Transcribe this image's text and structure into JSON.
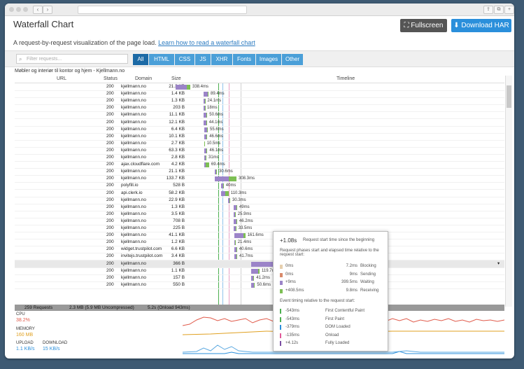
{
  "title": "Waterfall Chart",
  "fullscreen_label": "Fullscreen",
  "download_label": "Download HAR",
  "subtitle_text": "A request-by-request visualization of the page load.",
  "subtitle_link": "Learn how to read a waterfall chart",
  "filter_placeholder": "Filter requests...",
  "tabs": [
    "All",
    "HTML",
    "CSS",
    "JS",
    "XHR",
    "Fonts",
    "Images",
    "Other"
  ],
  "page_title": "Møbler og interiør til kontor og hjem - Kjellmann.no",
  "columns": {
    "url": "URL",
    "status": "Status",
    "domain": "Domain",
    "size": "Size",
    "timeline": "Timeline"
  },
  "colors": {
    "blocking": "#e6cfae",
    "sending": "#d98a6b",
    "waiting": "#9b84c8",
    "receiving": "#7dbf54",
    "accent": "#2a8fdb"
  },
  "rows": [
    {
      "url": "/",
      "status": "200",
      "domain": "kjellmann.no",
      "size": "21.3 KB",
      "time": "338.4ms",
      "start": 0,
      "wait": 155,
      "recv": 55
    },
    {
      "url": "logo.svg",
      "status": "200",
      "domain": "kjellmann.no",
      "size": "1.4 KB",
      "time": "89.4ms",
      "start": 395,
      "wait": 60,
      "recv": 15
    },
    {
      "url": "kjellmann-icon.avg",
      "status": "200",
      "domain": "kjellmann.no",
      "size": "1.3 KB",
      "time": "24.1ms",
      "start": 400,
      "wait": 20,
      "recv": 4
    },
    {
      "url": "dummy.png",
      "status": "200",
      "domain": "kjellmann.no",
      "size": "203 B",
      "time": "18ms",
      "start": 402,
      "wait": 14,
      "recv": 4
    },
    {
      "url": "kontormobler.jpg",
      "status": "200",
      "domain": "kjellmann.no",
      "size": "11.1 KB",
      "time": "50.6ms",
      "start": 403,
      "wait": 40,
      "recv": 10
    },
    {
      "url": "konferanse-og-moterom.jpg",
      "status": "200",
      "domain": "kjellmann.no",
      "size": "12.1 KB",
      "time": "44.1ms",
      "start": 404,
      "wait": 36,
      "recv": 8
    },
    {
      "url": "resepsjon.jpg",
      "status": "200",
      "domain": "kjellmann.no",
      "size": "6.4 KB",
      "time": "55.6ms",
      "start": 405,
      "wait": 45,
      "recv": 10
    },
    {
      "url": "presentasjon-whiteboard.jpg",
      "status": "200",
      "domain": "kjellmann.no",
      "size": "10.1 KB",
      "time": "46.6ms",
      "start": 406,
      "wait": 38,
      "recv": 8
    },
    {
      "url": "lounge.jpg",
      "status": "200",
      "domain": "kjellmann.no",
      "size": "2.7 KB",
      "time": "10.5ms",
      "start": 407,
      "wait": 8,
      "recv": 2
    },
    {
      "url": "styles.css",
      "status": "200",
      "domain": "kjellmann.no",
      "size": "63.3 KB",
      "time": "46.1ms",
      "start": 408,
      "wait": 30,
      "recv": 16
    },
    {
      "url": "amsecookie.css",
      "status": "200",
      "domain": "kjellmann.no",
      "size": "2.8 KB",
      "time": "31ms",
      "start": 409,
      "wait": 24,
      "recv": 7
    },
    {
      "url": "rocket-loader.min.js",
      "status": "200",
      "domain": "ajax.cloudflare.com",
      "size": "4.2 KB",
      "time": "69.4ms",
      "start": 410,
      "wait": 20,
      "recv": 49
    },
    {
      "url": "print.css",
      "status": "200",
      "domain": "kjellmann.no",
      "size": "21.1 KB",
      "time": "30.6ms",
      "start": 560,
      "wait": 24,
      "recv": 7
    },
    {
      "url": "fa-light-300.woff2",
      "status": "200",
      "domain": "kjellmann.no",
      "size": "133.7 KB",
      "time": "308.3ms",
      "start": 562,
      "wait": 200,
      "recv": 108
    },
    {
      "url": "polyfill.min.js?features=default%...",
      "status": "200",
      "domain": "polyfill.io",
      "size": "528 B",
      "time": "40ms",
      "start": 648,
      "wait": 30,
      "recv": 10
    },
    {
      "url": "clerk.js",
      "status": "200",
      "domain": "api.clerk.io",
      "size": "58.2 KB",
      "time": "110.3ms",
      "start": 648,
      "wait": 60,
      "recv": 50
    },
    {
      "url": "5f2e37e3fd9b3dea1dd53e9f31fb0...",
      "status": "200",
      "domain": "kjellmann.no",
      "size": "22.9 KB",
      "time": "30.3ms",
      "start": 750,
      "wait": 24,
      "recv": 6
    },
    {
      "url": "kjellmann-icon-color_2_.ico",
      "status": "200",
      "domain": "kjellmann.no",
      "size": "1.3 KB",
      "time": "49ms",
      "start": 830,
      "wait": 40,
      "recv": 9
    },
    {
      "url": "jquery.mobile.custom.min.js",
      "status": "200",
      "domain": "kjellmann.no",
      "size": "3.5 KB",
      "time": "25.9ms",
      "start": 832,
      "wait": 20,
      "recv": 6
    },
    {
      "url": "dataPost.min.js",
      "status": "200",
      "domain": "kjellmann.no",
      "size": "708 B",
      "time": "46.2ms",
      "start": 833,
      "wait": 38,
      "recv": 8
    },
    {
      "url": "bootstrap.min.js",
      "status": "200",
      "domain": "kjellmann.no",
      "size": "225 B",
      "time": "33.5ms",
      "start": 834,
      "wait": 27,
      "recv": 6
    },
    {
      "url": "jquery.min.js",
      "status": "200",
      "domain": "kjellmann.no",
      "size": "41.1 KB",
      "time": "161.6ms",
      "start": 835,
      "wait": 130,
      "recv": 32
    },
    {
      "url": "main.min.js",
      "status": "200",
      "domain": "kjellmann.no",
      "size": "1.2 KB",
      "time": "21.4ms",
      "start": 836,
      "wait": 17,
      "recv": 4
    },
    {
      "url": "tp.widget.bootstrap.min.js",
      "status": "200",
      "domain": "widget.trustpilot.com",
      "size": "6.6 KB",
      "time": "40.6ms",
      "start": 837,
      "wait": 30,
      "recv": 11
    },
    {
      "url": "tp.min.js",
      "status": "200",
      "domain": "invitejs.trustpilot.com",
      "size": "3.4 KB",
      "time": "41.7ms",
      "start": 838,
      "wait": 32,
      "recv": 10
    },
    {
      "url": "am.ShopbyResponsive.min.js",
      "status": "200",
      "domain": "kjellmann.no",
      "size": "366 B",
      "time": "",
      "start": 1080,
      "wait": 399.5,
      "recv": 9.8,
      "hl": true
    },
    {
      "url": "translate-inline.min.js",
      "status": "200",
      "domain": "kjellmann.no",
      "size": "1.1 KB",
      "time": "119.7ms",
      "start": 1080,
      "wait": 100,
      "recv": 20
    },
    {
      "url": "tooltip.min.js",
      "status": "200",
      "domain": "kjellmann.no",
      "size": "157 B",
      "time": "41.2ms",
      "start": 1082,
      "wait": 33,
      "recv": 8
    },
    {
      "url": "responsive.min.js",
      "status": "200",
      "domain": "kjellmann.no",
      "size": "550 B",
      "time": "50.6ms",
      "start": 1084,
      "wait": 40,
      "recv": 10
    }
  ],
  "summary": {
    "requests": "259 Requests",
    "size": "2.3 MB  (5.9 MB Uncompressed)",
    "time": "5.2s  (Onload 943ms)"
  },
  "metrics": {
    "cpu_label": "CPU",
    "cpu_value": "38.2%",
    "memory_label": "MEMORY",
    "memory_value": "160 MB",
    "upload_label": "UPLOAD",
    "upload_value": "1.1 KB/s",
    "download_label": "DOWNLOAD",
    "download_value": "15 KB/s"
  },
  "tooltip": {
    "start": "+1.08s",
    "start_desc": "Request start time since the beginning",
    "phases_desc": "Request phases start and elapsed time relative to the request start:",
    "phases": [
      {
        "start": "0ms",
        "elapsed": "7.2ms",
        "name": "Blocking",
        "color": "#e6cfae"
      },
      {
        "start": "0ms",
        "elapsed": "9ms",
        "name": "Sending",
        "color": "#d98a6b"
      },
      {
        "start": "+9ms",
        "elapsed": "399.5ms",
        "name": "Waiting",
        "color": "#9b84c8"
      },
      {
        "start": "+408.5ms",
        "elapsed": "9.8ms",
        "name": "Receiving",
        "color": "#7dbf54"
      }
    ],
    "events_desc": "Event timing relative to the request start:",
    "events": [
      {
        "time": "-543ms",
        "name": "First Contentful Paint",
        "color": "#4caf50"
      },
      {
        "time": "-543ms",
        "name": "First Paint",
        "color": "#4caf50"
      },
      {
        "time": "-379ms",
        "name": "DOM Loaded",
        "color": "#2a8fdb"
      },
      {
        "time": "-135ms",
        "name": "Onload",
        "color": "#e05a9a"
      },
      {
        "time": "+4.12s",
        "name": "Fully Loaded",
        "color": "#7a4ea3"
      }
    ]
  }
}
